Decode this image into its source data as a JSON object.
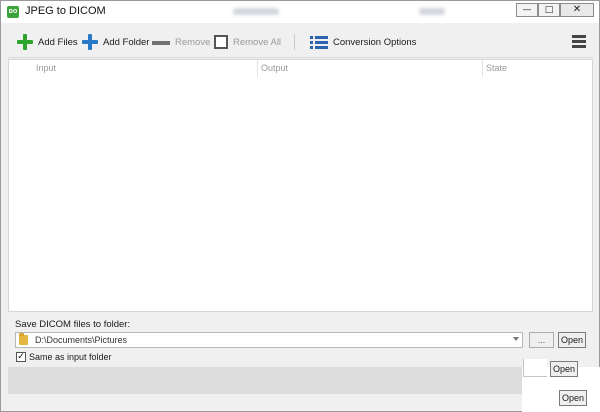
{
  "window": {
    "title": "JPEG to DICOM",
    "app_icon_text": "DO",
    "min_glyph": "—",
    "max_glyph": "□",
    "close_glyph": "✕"
  },
  "toolbar": {
    "add_files_label": "Add Files",
    "add_folder_label": "Add Folder",
    "remove_label": "Remove",
    "remove_all_label": "Remove All",
    "conversion_options_label": "Conversion Options",
    "icons": {
      "add_files": "plus-icon-green",
      "add_folder": "plus-icon-blue",
      "remove": "minus-icon",
      "remove_all": "square-icon",
      "conversion_options": "list-icon",
      "menu": "hamburger-menu-icon"
    }
  },
  "filelist": {
    "columns": [
      "Input",
      "Output",
      "State"
    ]
  },
  "output": {
    "save_label": "Save DICOM files to folder:",
    "path_value": "D:\\Documents\\Pictures",
    "browse_label": "...",
    "open_label": "Open",
    "same_as_input_label": "Same as input folder",
    "same_as_input_checked": true,
    "check_glyph": "✓"
  },
  "ghost_buttons": {
    "open_label_2": "Open",
    "open_label_3": "Open"
  },
  "colors": {
    "add_files_green": "#2da52d",
    "add_folder_blue": "#2879c8",
    "options_blue": "#2b63b0",
    "disabled_text": "#9a9a9a"
  }
}
